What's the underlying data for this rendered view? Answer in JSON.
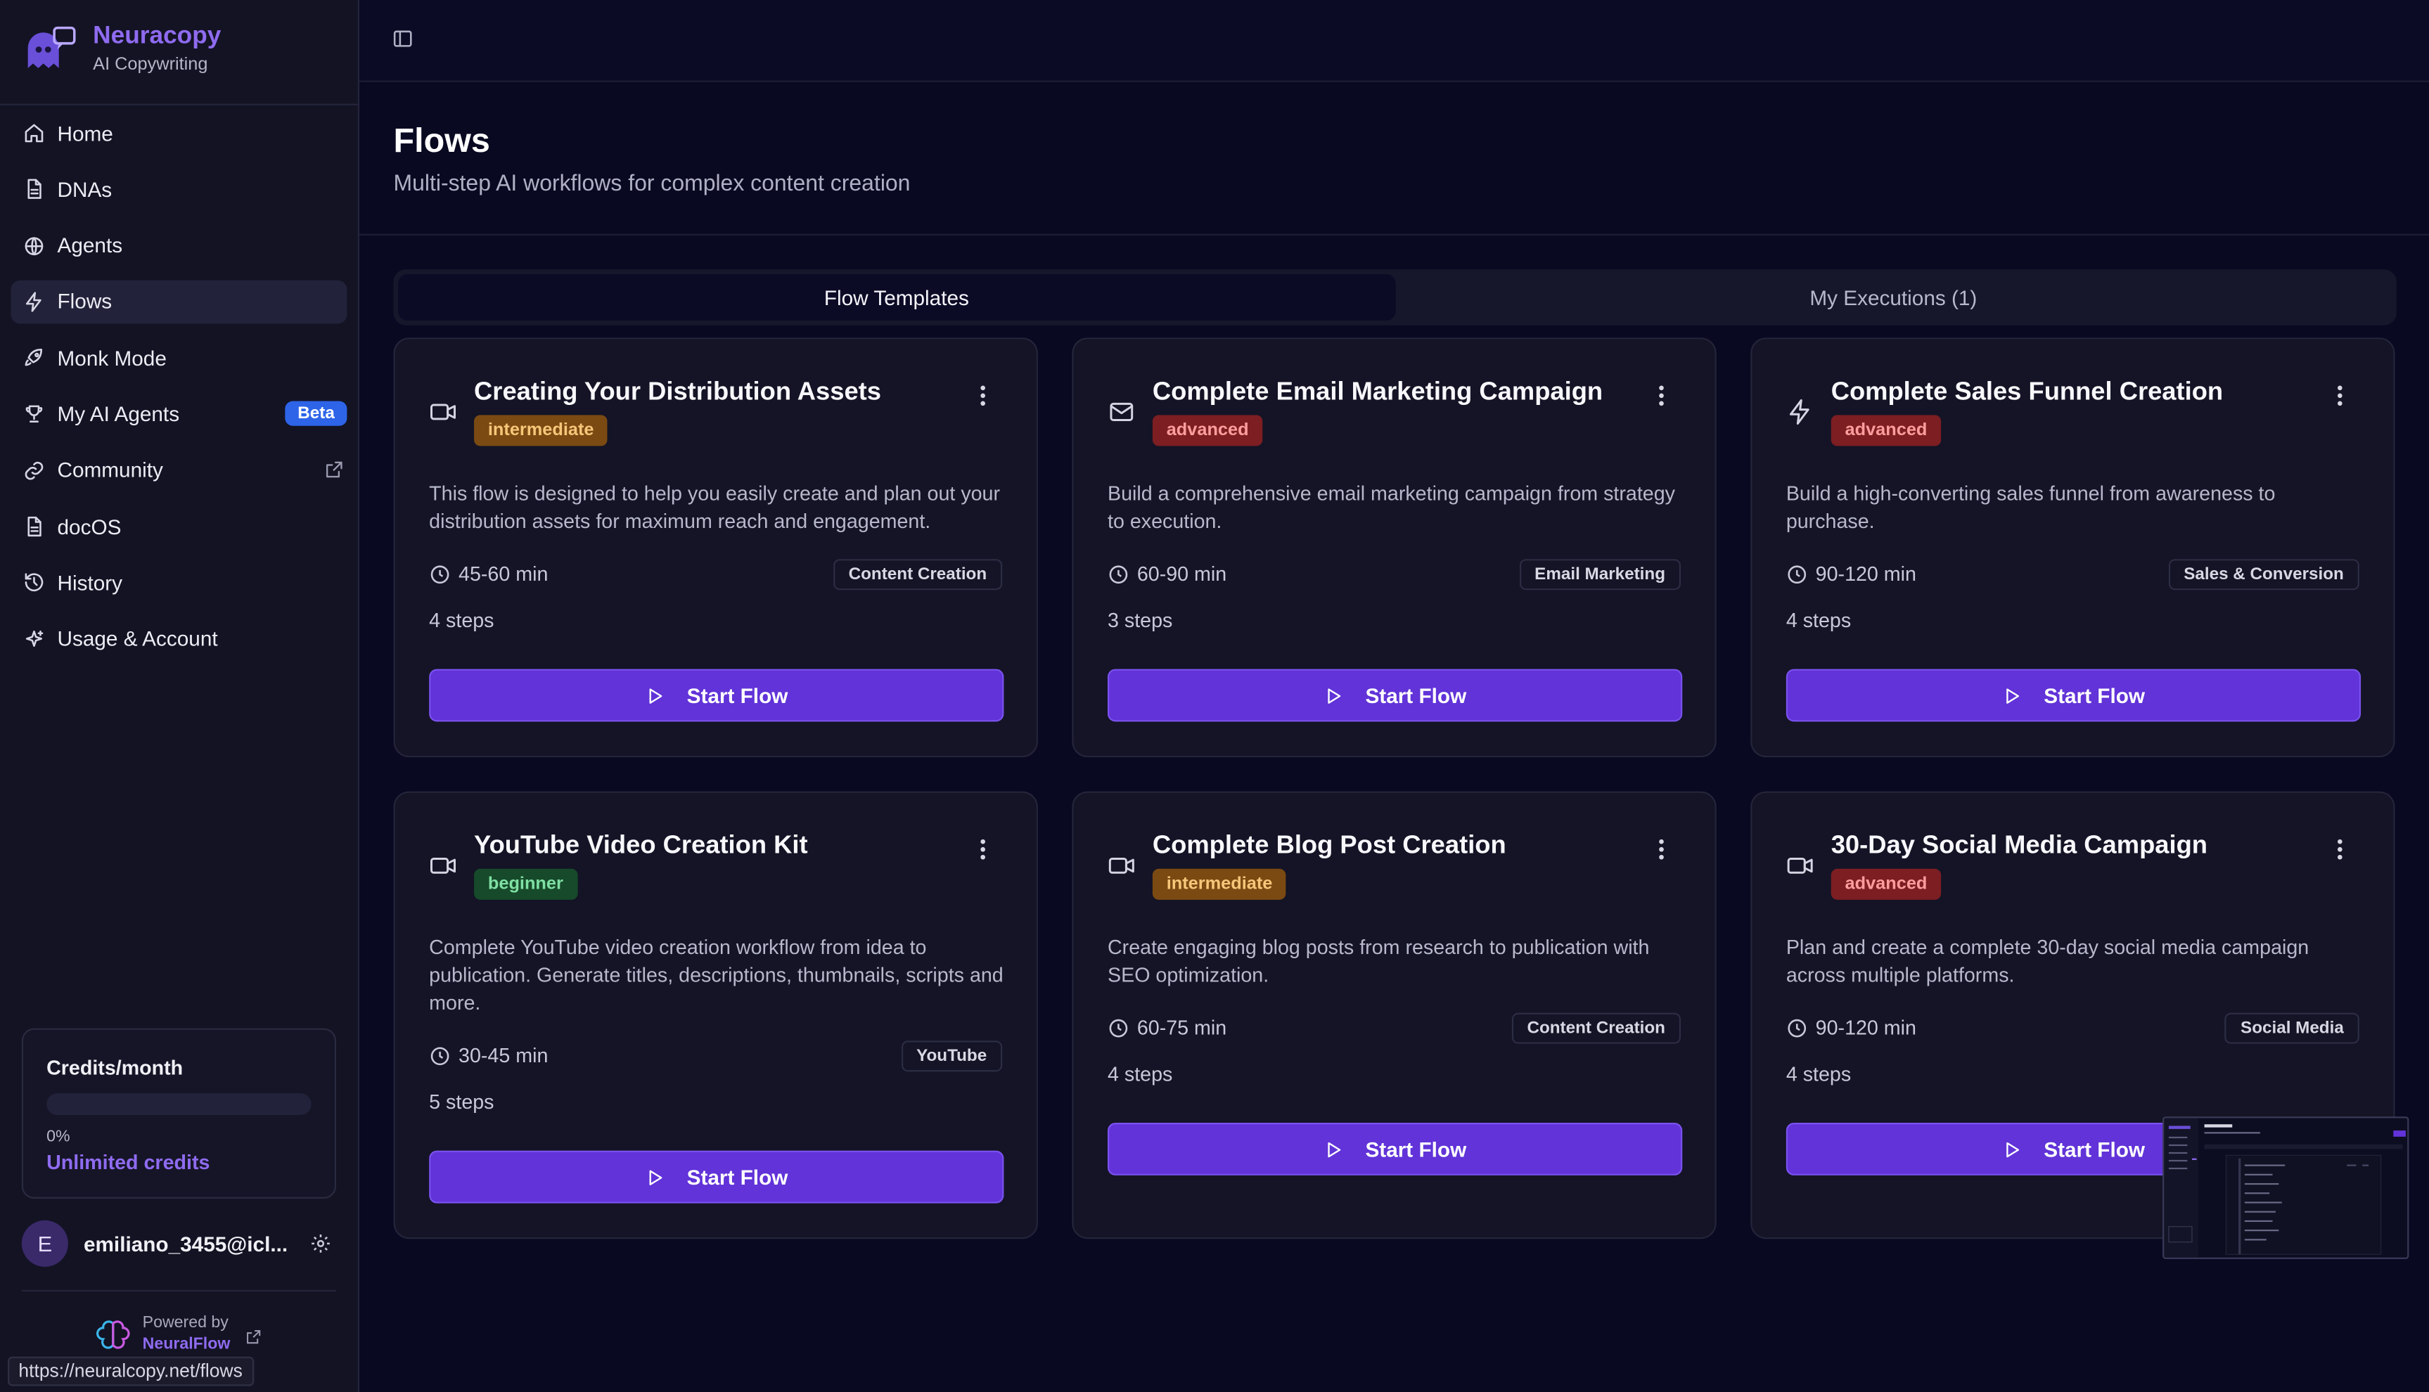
{
  "brand": {
    "name": "Neuracopy",
    "subtitle": "AI Copywriting"
  },
  "nav": [
    {
      "label": "Home",
      "icon": "home-icon"
    },
    {
      "label": "DNAs",
      "icon": "document-icon"
    },
    {
      "label": "Agents",
      "icon": "globe-icon"
    },
    {
      "label": "Flows",
      "icon": "bolt-icon",
      "active": true
    },
    {
      "label": "Monk Mode",
      "icon": "rocket-icon"
    },
    {
      "label": "My AI Agents",
      "icon": "trophy-icon",
      "badge": "Beta"
    },
    {
      "label": "Community",
      "icon": "link-icon",
      "external": true
    },
    {
      "label": "docOS",
      "icon": "document-icon"
    },
    {
      "label": "History",
      "icon": "history-icon"
    },
    {
      "label": "Usage & Account",
      "icon": "sparkle-icon"
    }
  ],
  "credits": {
    "title": "Credits/month",
    "percent_label": "0%",
    "fraction": 0,
    "unlimited": "Unlimited credits"
  },
  "user": {
    "initial": "E",
    "email": "emiliano_3455@icl..."
  },
  "powered": {
    "line1": "Powered by",
    "line2": "NeuralFlow"
  },
  "status_url": "https://neuralcopy.net/flows",
  "page": {
    "title": "Flows",
    "subtitle": "Multi-step AI workflows for complex content creation"
  },
  "tabs": [
    {
      "label": "Flow Templates",
      "active": true
    },
    {
      "label": "My Executions (1)",
      "active": false
    }
  ],
  "cards": [
    {
      "icon": "video-icon",
      "title": "Creating Your Distribution Assets",
      "level": "intermediate",
      "description": "This flow is designed to help you easily create and plan out your distribution assets for maximum reach and engagement.",
      "time": "45-60 min",
      "category": "Content Creation",
      "steps": "4 steps",
      "button": "Start Flow"
    },
    {
      "icon": "mail-icon",
      "title": "Complete Email Marketing Campaign",
      "level": "advanced",
      "description": "Build a comprehensive email marketing campaign from strategy to execution.",
      "time": "60-90 min",
      "category": "Email Marketing",
      "steps": "3 steps",
      "button": "Start Flow"
    },
    {
      "icon": "bolt-icon",
      "title": "Complete Sales Funnel Creation",
      "level": "advanced",
      "description": "Build a high-converting sales funnel from awareness to purchase.",
      "time": "90-120 min",
      "category": "Sales & Conversion",
      "steps": "4 steps",
      "button": "Start Flow"
    },
    {
      "icon": "video-icon",
      "title": "YouTube Video Creation Kit",
      "level": "beginner",
      "description": "Complete YouTube video creation workflow from idea to publication. Generate titles, descriptions, thumbnails, scripts and more.",
      "time": "30-45 min",
      "category": "YouTube",
      "steps": "5 steps",
      "button": "Start Flow"
    },
    {
      "icon": "video-icon",
      "title": "Complete Blog Post Creation",
      "level": "intermediate",
      "description": "Create engaging blog posts from research to publication with SEO optimization.",
      "time": "60-75 min",
      "category": "Content Creation",
      "steps": "4 steps",
      "button": "Start Flow"
    },
    {
      "icon": "video-icon",
      "title": "30-Day Social Media Campaign",
      "level": "advanced",
      "description": "Plan and create a complete 30-day social media campaign across multiple platforms.",
      "time": "90-120 min",
      "category": "Social Media",
      "steps": "4 steps",
      "button": "Start Flow"
    }
  ]
}
